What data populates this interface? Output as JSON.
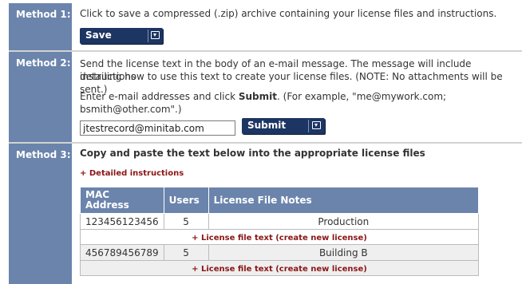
{
  "method1": {
    "label": "Method 1:",
    "text": "Click to save a compressed (.zip) archive containing your license files and instructions.",
    "save_label": "Save"
  },
  "method2": {
    "label": "Method 2:",
    "text_line1": "Send the license text in the body of an e-mail message. The message will include instructions",
    "text_line2": "detailing how to use this text to create your license files. (NOTE: No attachments will be sent.)",
    "enter_prefix": "Enter e-mail addresses and click ",
    "enter_bold": "Submit",
    "enter_suffix": ". (For example, \"me@mywork.com;",
    "enter_line2": "bsmith@other.com\".)",
    "email_value": "jtestrecord@minitab.com",
    "submit_label": "Submit"
  },
  "method3": {
    "label": "Method 3:",
    "heading": "Copy and paste the text below into the appropriate license files",
    "detailed_link": "+ Detailed instructions",
    "table": {
      "headers": [
        "MAC Address",
        "Users",
        "License File Notes"
      ],
      "rows": [
        {
          "mac": "123456123456",
          "users": "5",
          "notes": "Production",
          "link": "+ License file text (create new license)"
        },
        {
          "mac": "456789456789",
          "users": "5",
          "notes": "Building B",
          "link": "+ License file text (create new license)"
        }
      ]
    }
  }
}
